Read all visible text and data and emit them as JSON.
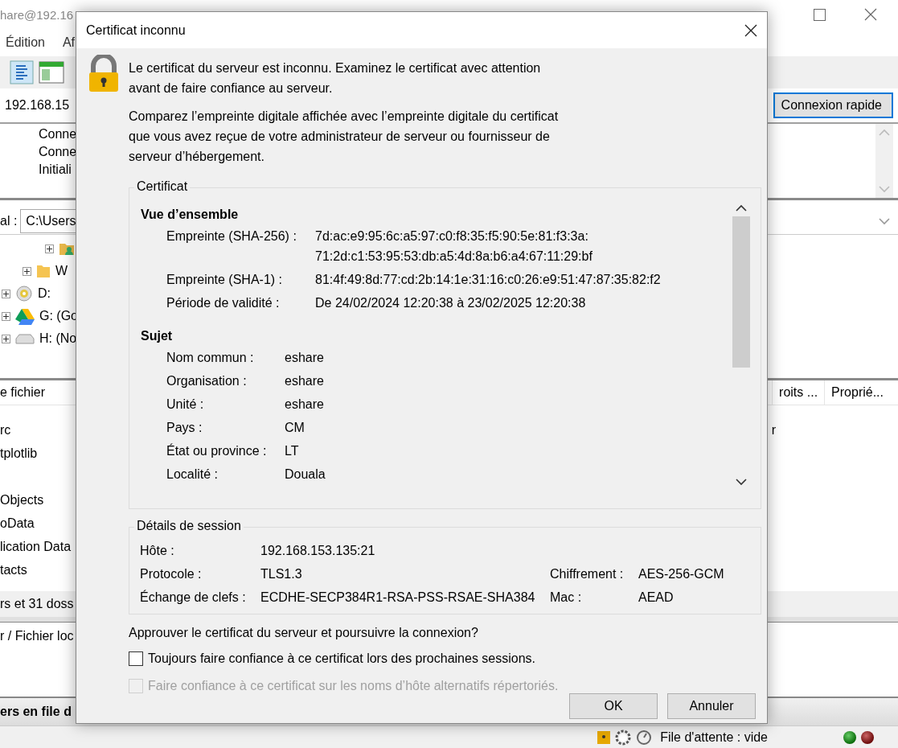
{
  "app": {
    "title": "hare@192.16",
    "menu": [
      "Édition",
      "Af"
    ],
    "host": "192.168.15",
    "quickconnect": "Connexion rapide",
    "log": [
      "Conne",
      "Conne",
      "Initiali"
    ],
    "local_label": "al :",
    "local_path": "C:\\Users",
    "tree": [
      {
        "kind": "user-folder",
        "expanded": false
      },
      {
        "kind": "folder",
        "label": "W",
        "expanded": false
      },
      {
        "kind": "disc",
        "label": "D:",
        "expanded": false
      },
      {
        "kind": "drive",
        "label": "G: (Go",
        "expanded": false
      },
      {
        "kind": "disk",
        "label": "H: (No",
        "expanded": false
      }
    ],
    "file_columns": [
      "e fichier"
    ],
    "remote_columns": [
      "roits ...",
      "Proprié..."
    ],
    "files": [
      {
        "name": "rc",
        "remote": "r"
      },
      {
        "name": "tplotlib"
      },
      {
        "name": "Objects"
      },
      {
        "name": "oData"
      },
      {
        "name": "lication Data"
      },
      {
        "name": "tacts"
      }
    ],
    "summary": "rs et 31 doss",
    "queue_column": "r / Fichier loc",
    "queue_tab": "ers en file d",
    "queue_status": "File d'attente : vide"
  },
  "dialog": {
    "title": "Certificat inconnu",
    "intro": [
      "Le certificat du serveur est inconnu. Examinez le certificat avec attention",
      "avant de faire confiance au serveur."
    ],
    "compare": [
      "Comparez l’empreinte digitale affichée avec l’empreinte digitale du certificat",
      "que vous avez reçue de votre administrateur de serveur ou fournisseur de",
      "serveur d’hébergement."
    ],
    "certificate_title": "Certificat",
    "sections": [
      {
        "heading": "Vue d’ensemble",
        "kind": "wide",
        "rows": [
          {
            "label": "Empreinte (SHA-256) :",
            "value": [
              "7d:ac:e9:95:6c:a5:97:c0:f8:35:f5:90:5e:81:f3:3a:",
              "71:2d:c1:53:95:53:db:a5:4d:8a:b6:a4:67:11:29:bf"
            ]
          },
          {
            "label": "Empreinte (SHA-1) :",
            "value": [
              "81:4f:49:8d:77:cd:2b:14:1e:31:16:c0:26:e9:51:47:87:35:82:f2"
            ]
          },
          {
            "label": "Période de validité :",
            "value": [
              "De 24/02/2024 12:20:38 à 23/02/2025 12:20:38"
            ]
          }
        ]
      },
      {
        "heading": "Sujet",
        "kind": "narrow",
        "rows": [
          {
            "label": "Nom commun :",
            "value": [
              "eshare"
            ]
          },
          {
            "label": "Organisation :",
            "value": [
              "eshare"
            ]
          },
          {
            "label": "Unité :",
            "value": [
              "eshare"
            ]
          },
          {
            "label": "Pays :",
            "value": [
              "CM"
            ]
          },
          {
            "label": "État ou province :",
            "value": [
              "LT"
            ]
          },
          {
            "label": "Localité :",
            "value": [
              "Douala"
            ]
          }
        ]
      }
    ],
    "session_title": "Détails de session",
    "session": [
      {
        "label": "Hôte :",
        "value": "192.168.153.135:21"
      },
      {
        "label": "Protocole :",
        "value": "TLS1.3",
        "label2": "Chiffrement :",
        "value2": "AES-256-GCM"
      },
      {
        "label": "Échange de clefs :",
        "value": "ECDHE-SECP384R1-RSA-PSS-RSAE-SHA384",
        "label2": "Mac :",
        "value2": "AEAD"
      }
    ],
    "question": "Approuver le certificat du serveur et poursuivre la connexion?",
    "options": [
      {
        "label": "Toujours faire confiance à ce certificat lors des prochaines sessions.",
        "checked": false,
        "disabled": false
      },
      {
        "label": "Faire confiance à ce certificat sur les noms d’hôte alternatifs répertoriés.",
        "checked": false,
        "disabled": true
      }
    ],
    "buttons": [
      "OK",
      "Annuler"
    ]
  }
}
